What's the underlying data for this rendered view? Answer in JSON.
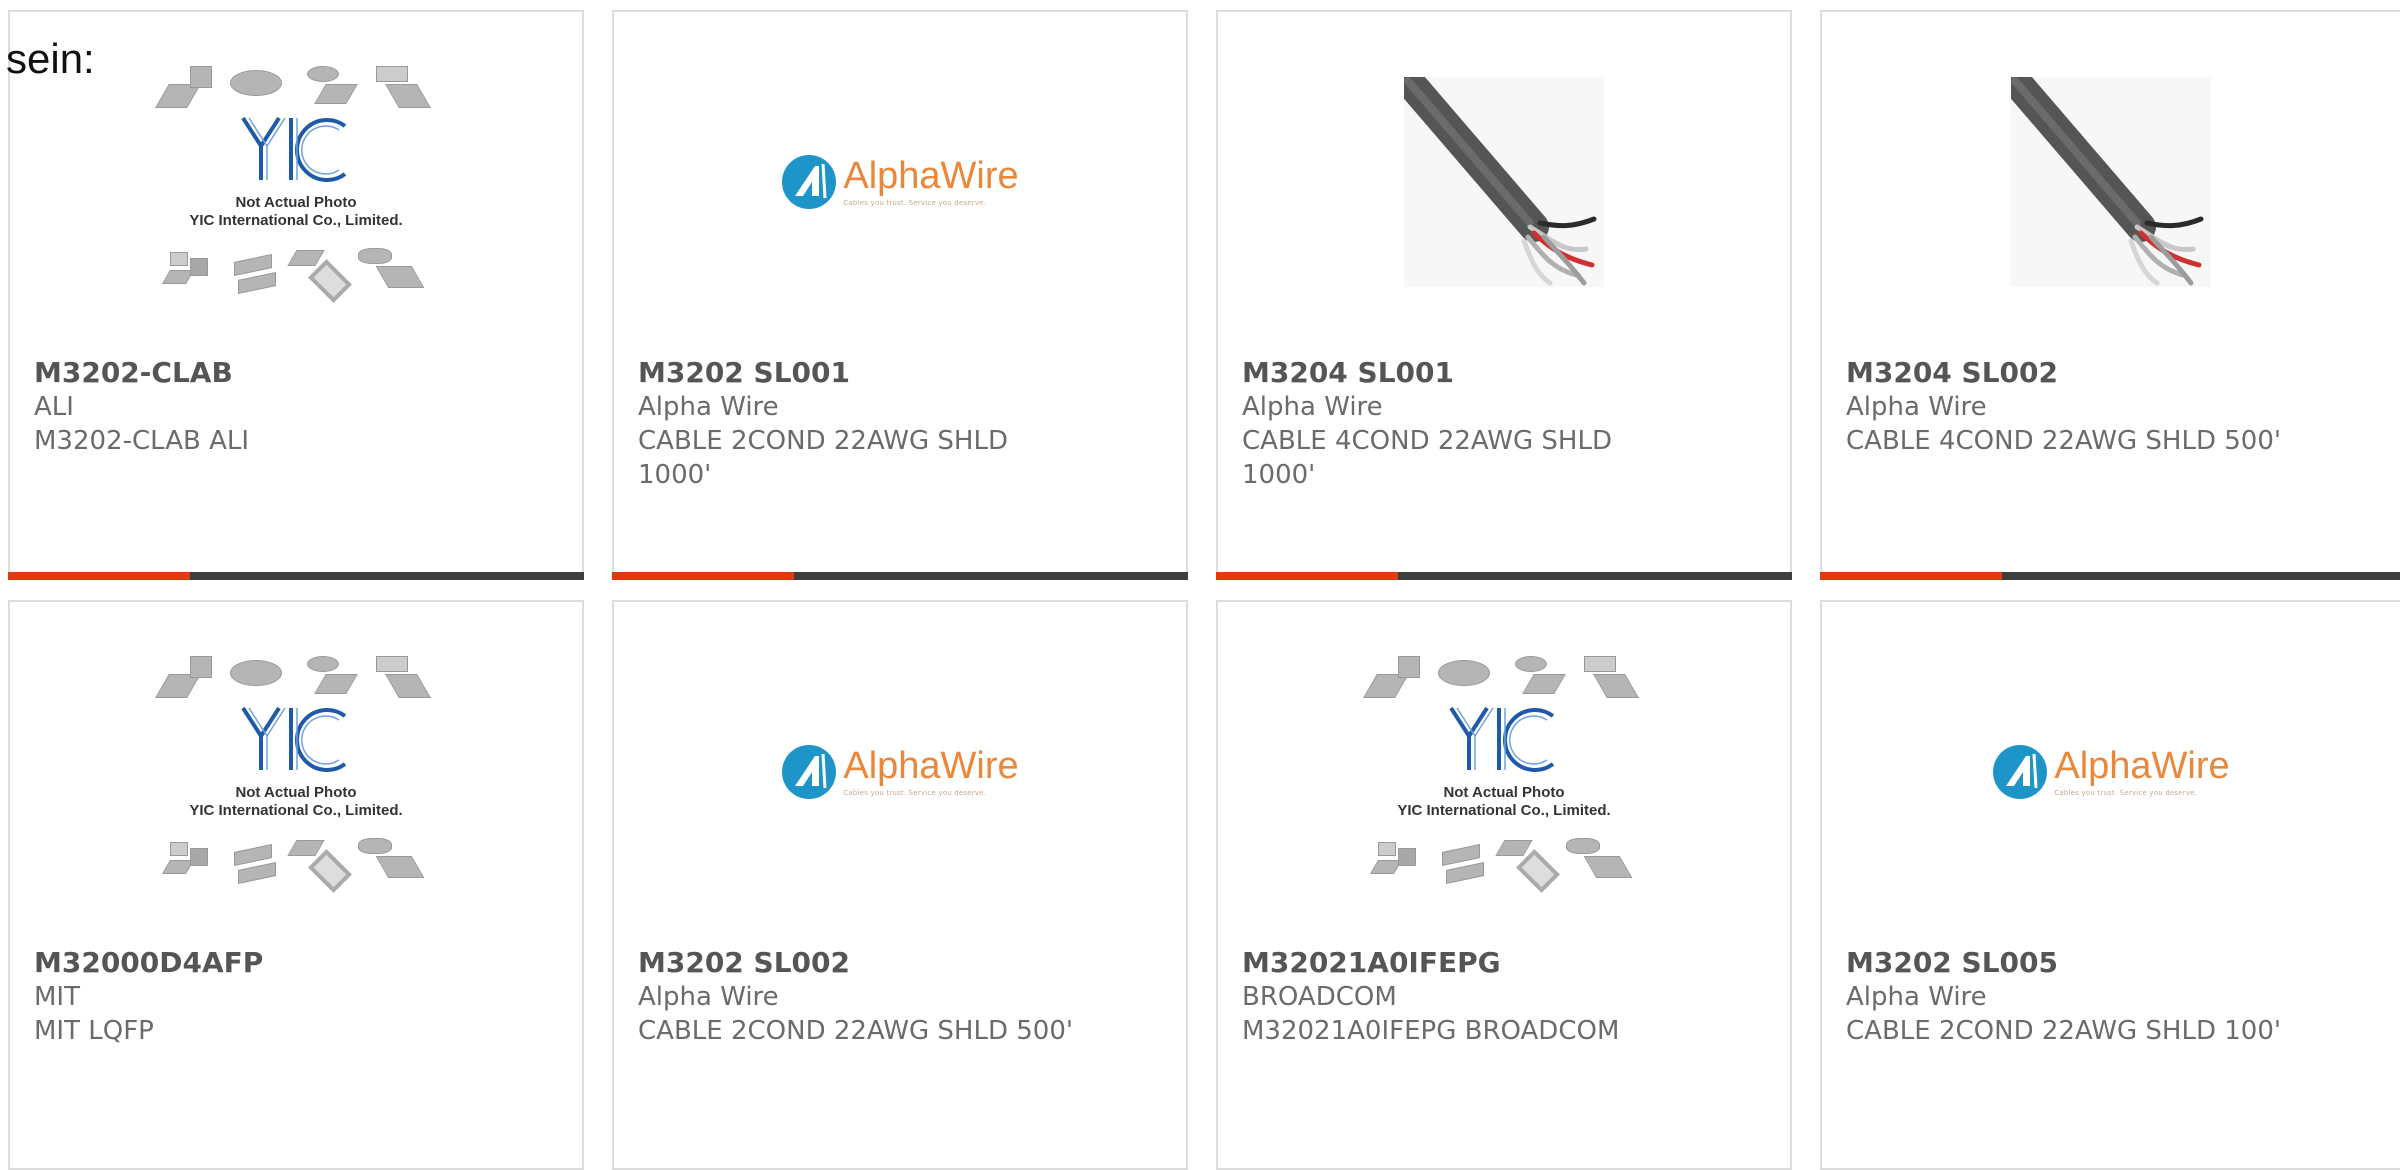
{
  "fragment_text": "sein:",
  "colors": {
    "accent_bar": "#e23a0f",
    "bar_rest": "#3f3f3f",
    "border": "#dcdcdc"
  },
  "placeholder": {
    "line1": "Not Actual Photo",
    "line2": "YIC International Co., Limited."
  },
  "alphawire_logo": {
    "name": "AlphaWire",
    "tagline": "Cables you trust. Service you deserve."
  },
  "cards": [
    {
      "part_number": "M3202-CLAB",
      "manufacturer": "ALI",
      "description": "M3202-CLAB ALI",
      "image": "yic-placeholder"
    },
    {
      "part_number": "M3202 SL001",
      "manufacturer": "Alpha Wire",
      "description": "CABLE 2COND 22AWG SHLD 1000'",
      "image": "alphawire-logo"
    },
    {
      "part_number": "M3204 SL001",
      "manufacturer": "Alpha Wire",
      "description": "CABLE 4COND 22AWG SHLD 1000'",
      "image": "cable-photo"
    },
    {
      "part_number": "M3204 SL002",
      "manufacturer": "Alpha Wire",
      "description": "CABLE 4COND 22AWG SHLD 500'",
      "image": "cable-photo"
    },
    {
      "part_number": "M32000D4AFP",
      "manufacturer": "MIT",
      "description": "MIT LQFP",
      "image": "yic-placeholder"
    },
    {
      "part_number": "M3202 SL002",
      "manufacturer": "Alpha Wire",
      "description": "CABLE 2COND 22AWG SHLD 500'",
      "image": "alphawire-logo"
    },
    {
      "part_number": "M32021A0IFEPG",
      "manufacturer": "BROADCOM",
      "description": "M32021A0IFEPG BROADCOM",
      "image": "yic-placeholder"
    },
    {
      "part_number": "M3202 SL005",
      "manufacturer": "Alpha Wire",
      "description": "CABLE 2COND 22AWG SHLD 100'",
      "image": "alphawire-logo"
    }
  ]
}
